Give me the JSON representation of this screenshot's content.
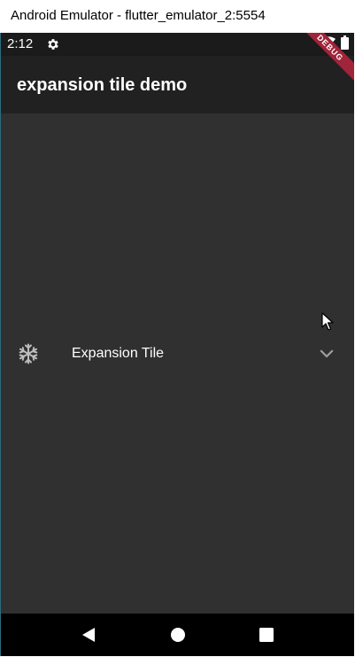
{
  "window": {
    "title": "Android Emulator - flutter_emulator_2:5554"
  },
  "status_bar": {
    "time": "2:12",
    "icons": [
      "settings-icon",
      "wifi-icon",
      "battery-icon"
    ]
  },
  "app_bar": {
    "title": "expansion tile demo",
    "debug_banner": "DEBUG"
  },
  "expansion_tile": {
    "leading_icon": "snowflake-icon",
    "title": "Expansion Tile",
    "trailing_icon": "chevron-down-icon",
    "expanded": false
  },
  "nav_bar": {
    "buttons": [
      "back-icon",
      "home-icon",
      "recents-icon"
    ]
  },
  "colors": {
    "background": "#303030",
    "app_bar": "#212121",
    "status_bar": "#1b1b1b",
    "debug_banner": "#a0243a",
    "text": "#ffffff"
  }
}
